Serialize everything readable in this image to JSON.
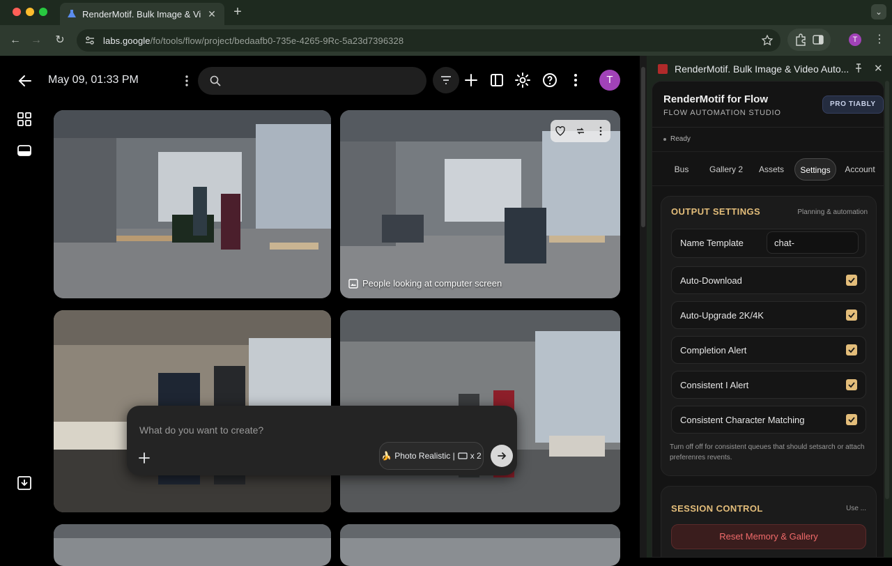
{
  "browser": {
    "tab_title": "RenderMotif. Bulk Image & Video",
    "url_host": "labs.google",
    "url_path": "/fo/tools/flow/project/bedaafb0-735e-4265-9Rc-5a23d7396328",
    "profile_initial": "T"
  },
  "app": {
    "title": "May 09, 01:33 PM",
    "search_placeholder": "",
    "avatar_initial": "T",
    "tile_caption": "People looking at computer screen",
    "prompt_placeholder": "What do you want to create?",
    "mode_label": "Photo Realistic |",
    "mode_count": "x 2"
  },
  "panel": {
    "title": "RenderMotif. Bulk Image & Video Auto...",
    "brand": "RenderMotif for Flow",
    "subtitle": "FLOW AUTOMATION STUDIO",
    "badge": "PRO TIABLY",
    "status": "Ready",
    "tabs": [
      "Bus",
      "Gallery 2",
      "Assets",
      "Settings",
      "Account"
    ],
    "active_tab": "Settings",
    "output": {
      "heading": "OUTPUT SETTINGS",
      "hint": "Planning & automation",
      "name_template_label": "Name Template",
      "name_template_value": "chat-",
      "toggles": [
        {
          "label": "Auto-Download",
          "checked": true
        },
        {
          "label": "Auto-Upgrade 2K/4K",
          "checked": true
        },
        {
          "label": "Completion Alert",
          "checked": true
        },
        {
          "label": "Consistent I Alert",
          "checked": true
        },
        {
          "label": "Consistent Character Matching",
          "checked": true
        }
      ],
      "note": "Turn off off for consistent queues that should setsarch or attach preferenres revents."
    },
    "session": {
      "heading": "SESSION CONTROL",
      "hint": "Use ...",
      "reset_label": "Reset Memory & Gallery"
    }
  },
  "colors": {
    "accent": "#e3bd7a",
    "danger": "#f06a6a",
    "avatar": "#a142b8"
  }
}
